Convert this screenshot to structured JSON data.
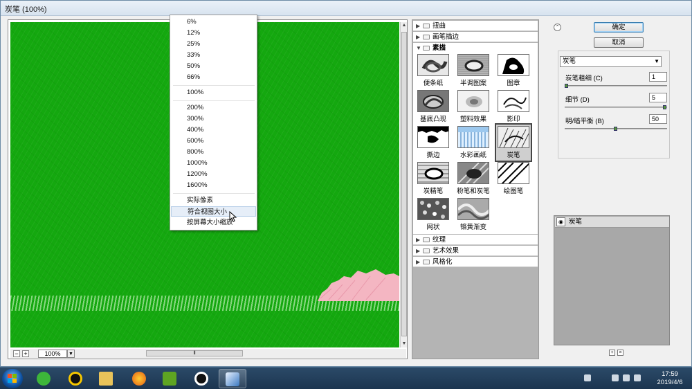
{
  "window": {
    "title": "炭笔 (100%)"
  },
  "preview": {
    "zoom_value": "100%",
    "zoom_minus": "−",
    "zoom_plus": "+"
  },
  "zoom_menu": {
    "group1": [
      "6%",
      "12%",
      "25%",
      "33%",
      "50%",
      "66%"
    ],
    "group2": [
      "100%"
    ],
    "group3": [
      "200%",
      "300%",
      "400%",
      "600%",
      "800%",
      "1000%",
      "1200%",
      "1600%"
    ],
    "group4": [
      "实际像素",
      "符合视图大小",
      "按屏幕大小缩放"
    ],
    "highlighted": "符合视图大小"
  },
  "gallery": {
    "categories_top": [
      "扭曲",
      "画笔描边",
      "素描"
    ],
    "categories_bottom": [
      "纹理",
      "艺术效果",
      "风格化"
    ],
    "expanded": "素描",
    "filters": [
      "便条纸",
      "半调图案",
      "图章",
      "基底凸现",
      "塑料效果",
      "影印",
      "撕边",
      "水彩画纸",
      "炭笔",
      "炭精笔",
      "粉笔和炭笔",
      "绘图笔",
      "网状",
      "铬黄渐变"
    ],
    "selected": "炭笔"
  },
  "panel": {
    "ok": "确定",
    "cancel": "取消",
    "filter_select": "炭笔",
    "sliders": [
      {
        "label": "炭笔粗细 (C)",
        "value": "1",
        "fraction": 0.0
      },
      {
        "label": "细节 (D)",
        "value": "5",
        "fraction": 1.0
      },
      {
        "label": "明/暗平衡 (B)",
        "value": "50",
        "fraction": 0.5
      }
    ],
    "layer_name": "炭笔"
  },
  "taskbar": {
    "time": "17:59",
    "date": "2019/4/6"
  },
  "colors": {
    "canvas_green": "#14a80f",
    "pink_patch": "#f4b6c2",
    "selection": "#3c7fb1"
  }
}
